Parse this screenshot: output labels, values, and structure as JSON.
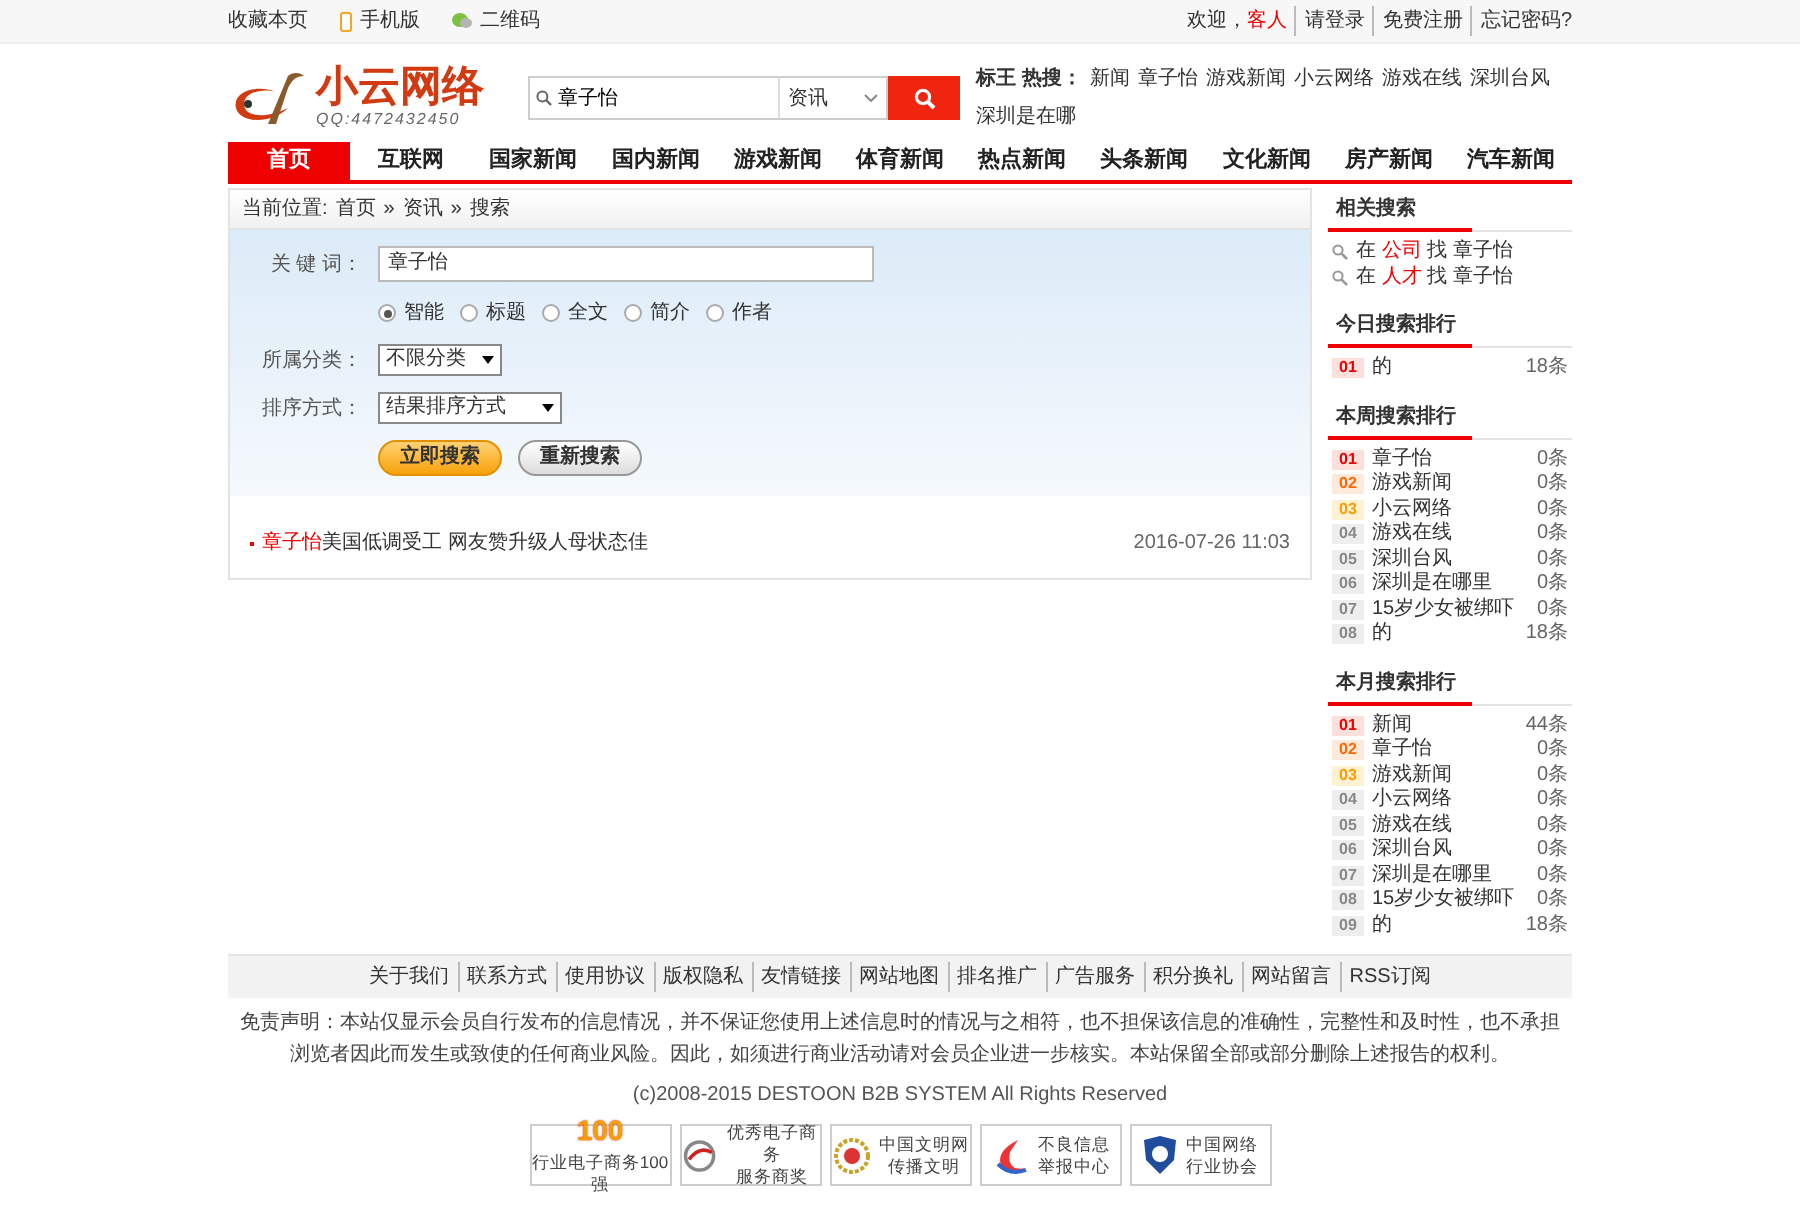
{
  "top_bar": {
    "left": [
      {
        "label": "收藏本页",
        "kind": "text"
      },
      {
        "label": "手机版",
        "kind": "phone"
      },
      {
        "label": "二维码",
        "kind": "qr"
      }
    ],
    "welcome": "欢迎，",
    "user": "客人",
    "links": [
      "请登录",
      "免费注册",
      "忘记密码?"
    ]
  },
  "header": {
    "logo": {
      "title": "小云网络",
      "tagline": "QQ:4472432450"
    },
    "search": {
      "value": "章子怡",
      "category": "资讯"
    },
    "hot": {
      "label": "标王 热搜：",
      "items": [
        "新闻",
        "章子怡",
        "游戏新闻",
        "小云网络",
        "游戏在线",
        "深圳台风",
        "深圳是在哪"
      ]
    }
  },
  "nav": [
    {
      "label": "首页",
      "selected": true
    },
    {
      "label": "互联网",
      "selected": false
    },
    {
      "label": "国家新闻",
      "selected": false
    },
    {
      "label": "国内新闻",
      "selected": false
    },
    {
      "label": "游戏新闻",
      "selected": false
    },
    {
      "label": "体育新闻",
      "selected": false
    },
    {
      "label": "热点新闻",
      "selected": false
    },
    {
      "label": "头条新闻",
      "selected": false
    },
    {
      "label": "文化新闻",
      "selected": false
    },
    {
      "label": "房产新闻",
      "selected": false
    },
    {
      "label": "汽车新闻",
      "selected": false
    }
  ],
  "breadcrumb": {
    "label": "当前位置:",
    "separator": "»",
    "items": [
      "首页",
      "资讯",
      "搜索"
    ]
  },
  "search_form": {
    "keyword_label": "关 键 词：",
    "keyword": "章子怡",
    "modes": [
      {
        "label": "智能",
        "selected": true
      },
      {
        "label": "标题",
        "selected": false
      },
      {
        "label": "全文",
        "selected": false
      },
      {
        "label": "简介",
        "selected": false
      },
      {
        "label": "作者",
        "selected": false
      }
    ],
    "category_label": "所属分类：",
    "category": "不限分类",
    "sort_label": "排序方式：",
    "sort": "结果排序方式",
    "buttons": [
      {
        "label": "立即搜索",
        "kind": "primary"
      },
      {
        "label": "重新搜索",
        "kind": "secondary"
      }
    ]
  },
  "results": [
    {
      "highlight": "章子怡",
      "title": "美国低调受工 网友赞升级人母状态佳",
      "date": "2016-07-26 11:03"
    }
  ],
  "sidebar": {
    "related": {
      "title": "相关搜索",
      "items": [
        {
          "prefix": "在",
          "target": "公司",
          "verb": "找",
          "keyword": "章子怡"
        },
        {
          "prefix": "在",
          "target": "人才",
          "verb": "找",
          "keyword": "章子怡"
        }
      ]
    },
    "rankings": [
      {
        "title": "今日搜索排行",
        "items": [
          {
            "rank": "01",
            "term": "的",
            "count": "18条"
          }
        ]
      },
      {
        "title": "本周搜索排行",
        "items": [
          {
            "rank": "01",
            "term": "章子怡",
            "count": "0条"
          },
          {
            "rank": "02",
            "term": "游戏新闻",
            "count": "0条"
          },
          {
            "rank": "03",
            "term": "小云网络",
            "count": "0条"
          },
          {
            "rank": "04",
            "term": "游戏在线",
            "count": "0条"
          },
          {
            "rank": "05",
            "term": "深圳台风",
            "count": "0条"
          },
          {
            "rank": "06",
            "term": "深圳是在哪里",
            "count": "0条"
          },
          {
            "rank": "07",
            "term": "15岁少女被绑吓",
            "count": "0条"
          },
          {
            "rank": "08",
            "term": "的",
            "count": "18条"
          }
        ]
      },
      {
        "title": "本月搜索排行",
        "items": [
          {
            "rank": "01",
            "term": "新闻",
            "count": "44条"
          },
          {
            "rank": "02",
            "term": "章子怡",
            "count": "0条"
          },
          {
            "rank": "03",
            "term": "游戏新闻",
            "count": "0条"
          },
          {
            "rank": "04",
            "term": "小云网络",
            "count": "0条"
          },
          {
            "rank": "05",
            "term": "游戏在线",
            "count": "0条"
          },
          {
            "rank": "06",
            "term": "深圳台风",
            "count": "0条"
          },
          {
            "rank": "07",
            "term": "深圳是在哪里",
            "count": "0条"
          },
          {
            "rank": "08",
            "term": "15岁少女被绑吓",
            "count": "0条"
          },
          {
            "rank": "09",
            "term": "的",
            "count": "18条"
          }
        ]
      }
    ]
  },
  "footer": {
    "links": [
      "关于我们",
      "联系方式",
      "使用协议",
      "版权隐私",
      "友情链接",
      "网站地图",
      "排名推广",
      "广告服务",
      "积分换礼",
      "网站留言",
      "RSS订阅"
    ],
    "disclaimer": "免责声明：本站仅显示会员自行发布的信息情况，并不保证您使用上述信息时的情况与之相符，也不担保该信息的准确性，完整性和及时性，也不承担浏览者因此而发生或致使的任何商业风险。因此，如须进行商业活动请对会员企业进一步核实。本站保留全部或部分删除上述报告的权利。",
    "copyright": "(c)2008-2015 DESTOON B2B SYSTEM All Rights Reserved",
    "badges": [
      {
        "kind": "top100",
        "mark": "100",
        "lines": [
          "行业电子商务100强"
        ]
      },
      {
        "kind": "award",
        "lines": [
          "优秀电子商务",
          "服务商奖"
        ]
      },
      {
        "kind": "wreath",
        "lines": [
          "中国文明网",
          "传播文明"
        ]
      },
      {
        "kind": "swoosh",
        "lines": [
          "不良信息",
          "举报中心"
        ]
      },
      {
        "kind": "shield",
        "lines": [
          "中国网络",
          "行业协会"
        ]
      }
    ]
  }
}
